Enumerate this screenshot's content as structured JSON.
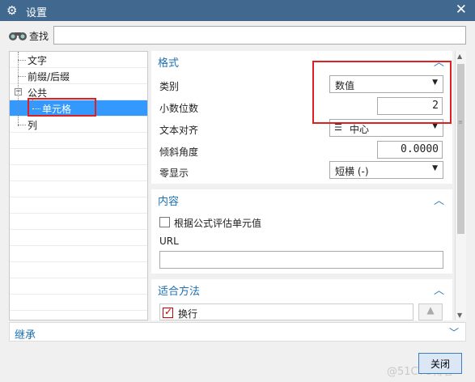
{
  "window": {
    "title": "设置",
    "close_glyph": "✕"
  },
  "search": {
    "label": "查找",
    "value": ""
  },
  "tree": {
    "items": [
      {
        "label": "文字"
      },
      {
        "label": "前缀/后缀"
      },
      {
        "label": "公共",
        "expander": "−"
      },
      {
        "label": "单元格",
        "selected": true
      },
      {
        "label": "列"
      }
    ]
  },
  "format": {
    "header": "格式",
    "category_label": "类别",
    "category_value": "数值",
    "decimals_label": "小数位数",
    "decimals_value": "2",
    "align_label": "文本对齐",
    "align_value": "中心",
    "angle_label": "倾斜角度",
    "angle_value": "0.0000",
    "zero_label": "零显示",
    "zero_value": "短横 (-)"
  },
  "content": {
    "header": "内容",
    "formula_label": "根据公式评估单元值",
    "formula_checked": false,
    "url_label": "URL",
    "url_value": ""
  },
  "fit": {
    "header": "适合方法",
    "wrap_label": "换行",
    "wrap_checked": true
  },
  "inherit": {
    "label": "继承"
  },
  "buttons": {
    "close": "关闭"
  },
  "watermark": "@51CTO博客",
  "colors": {
    "titlebar": "#41698f",
    "section_header": "#1e6fb0",
    "selection": "#3399ff",
    "highlight_box": "#e02020"
  },
  "icons": {
    "settings": "gear-icon",
    "search": "binocular-icon",
    "collapse": "chevron-up-icon",
    "expand": "chevron-down-icon"
  }
}
